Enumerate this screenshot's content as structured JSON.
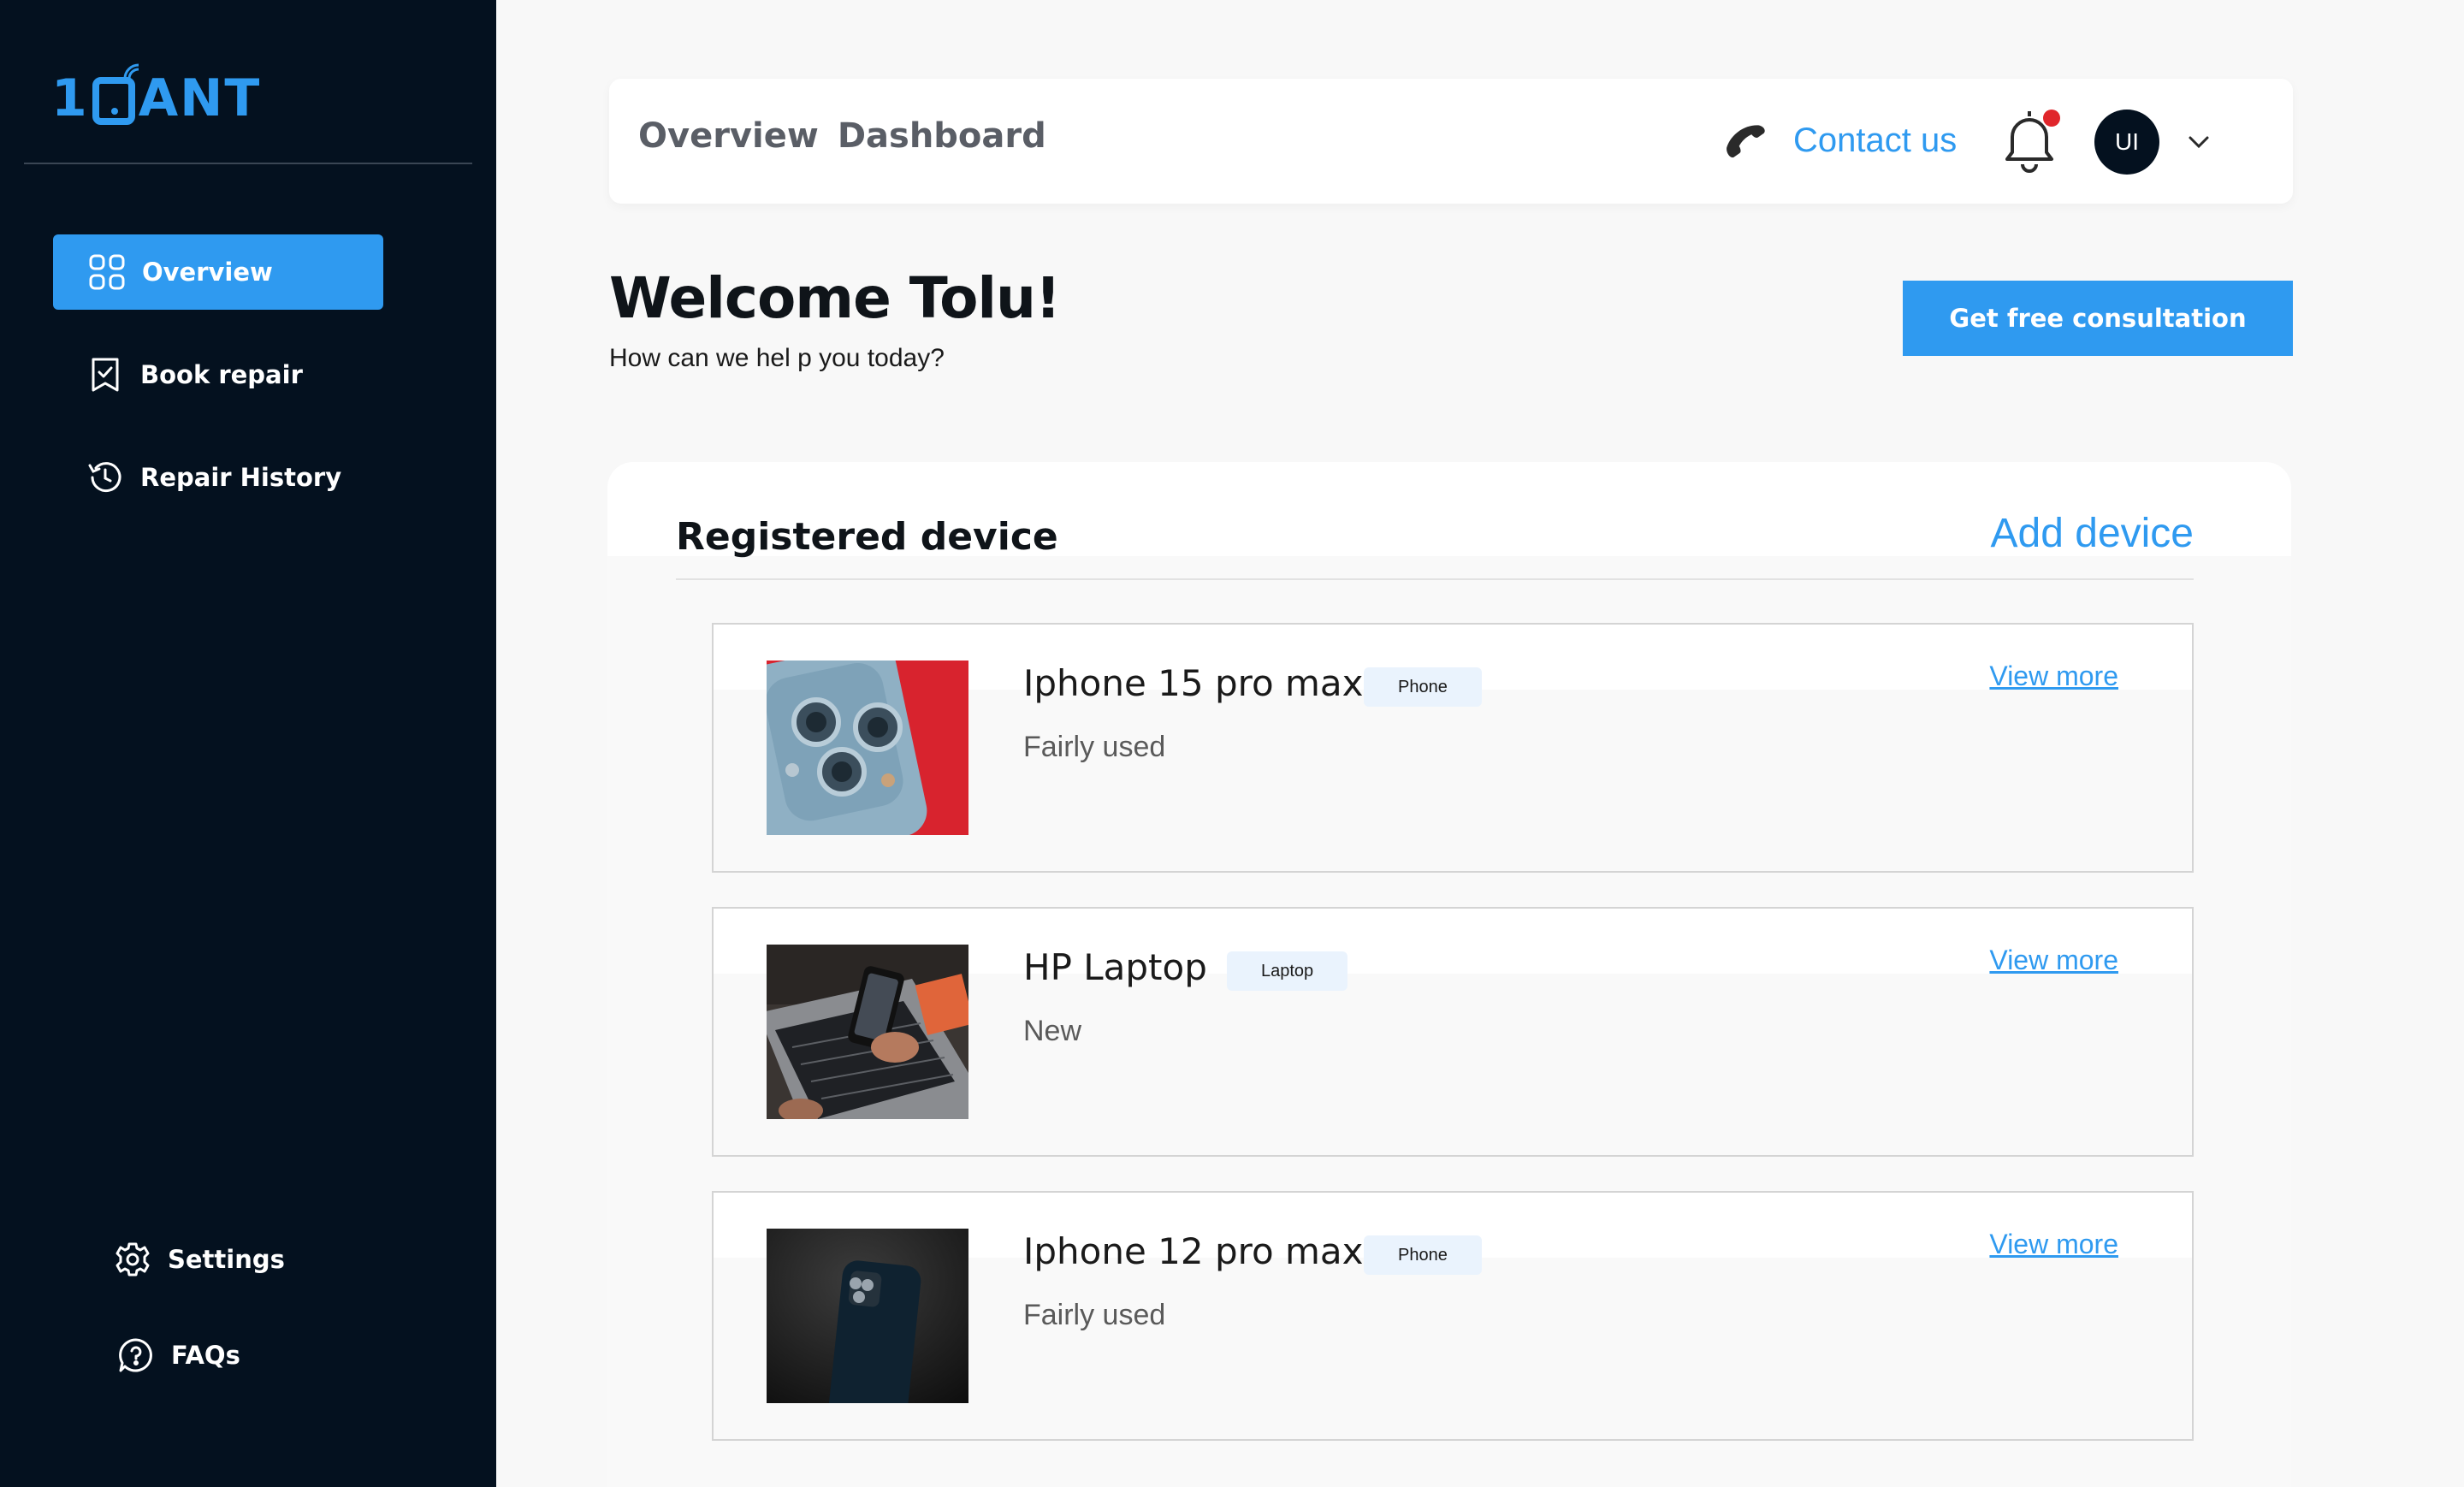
{
  "brand": {
    "logo_prefix": "1",
    "logo_suffix": "ANT",
    "accent": "#2f9af0",
    "sidebar_bg": "#04111f"
  },
  "sidebar": {
    "items": [
      {
        "label": "Overview",
        "icon": "grid-icon",
        "active": true
      },
      {
        "label": "Book repair",
        "icon": "bookmark-check-icon",
        "active": false
      },
      {
        "label": "Repair History",
        "icon": "history-icon",
        "active": false
      }
    ],
    "bottom_items": [
      {
        "label": "Settings",
        "icon": "gear-icon"
      },
      {
        "label": "FAQs",
        "icon": "chat-question-icon"
      }
    ]
  },
  "header": {
    "title_part1": "Overview",
    "title_part2": "Dashboard",
    "contact_label": "Contact us",
    "avatar_initials": "UI",
    "notification_dot_color": "#e0262b"
  },
  "welcome": {
    "title": "Welcome Tolu!",
    "subtitle": "How can we hel p you today?",
    "cta_label": "Get free consultation"
  },
  "devices": {
    "title": "Registered device",
    "add_label": "Add device",
    "items": [
      {
        "name": "Iphone 15 pro max",
        "type": "Phone",
        "condition": "Fairly used",
        "link": "View more",
        "image": "iphone-15-photo"
      },
      {
        "name": "HP Laptop",
        "type": "Laptop",
        "condition": "New",
        "link": "View more",
        "image": "hp-laptop-photo"
      },
      {
        "name": "Iphone 12 pro max",
        "type": "Phone",
        "condition": "Fairly used",
        "link": "View more",
        "image": "iphone-12-photo"
      }
    ]
  }
}
